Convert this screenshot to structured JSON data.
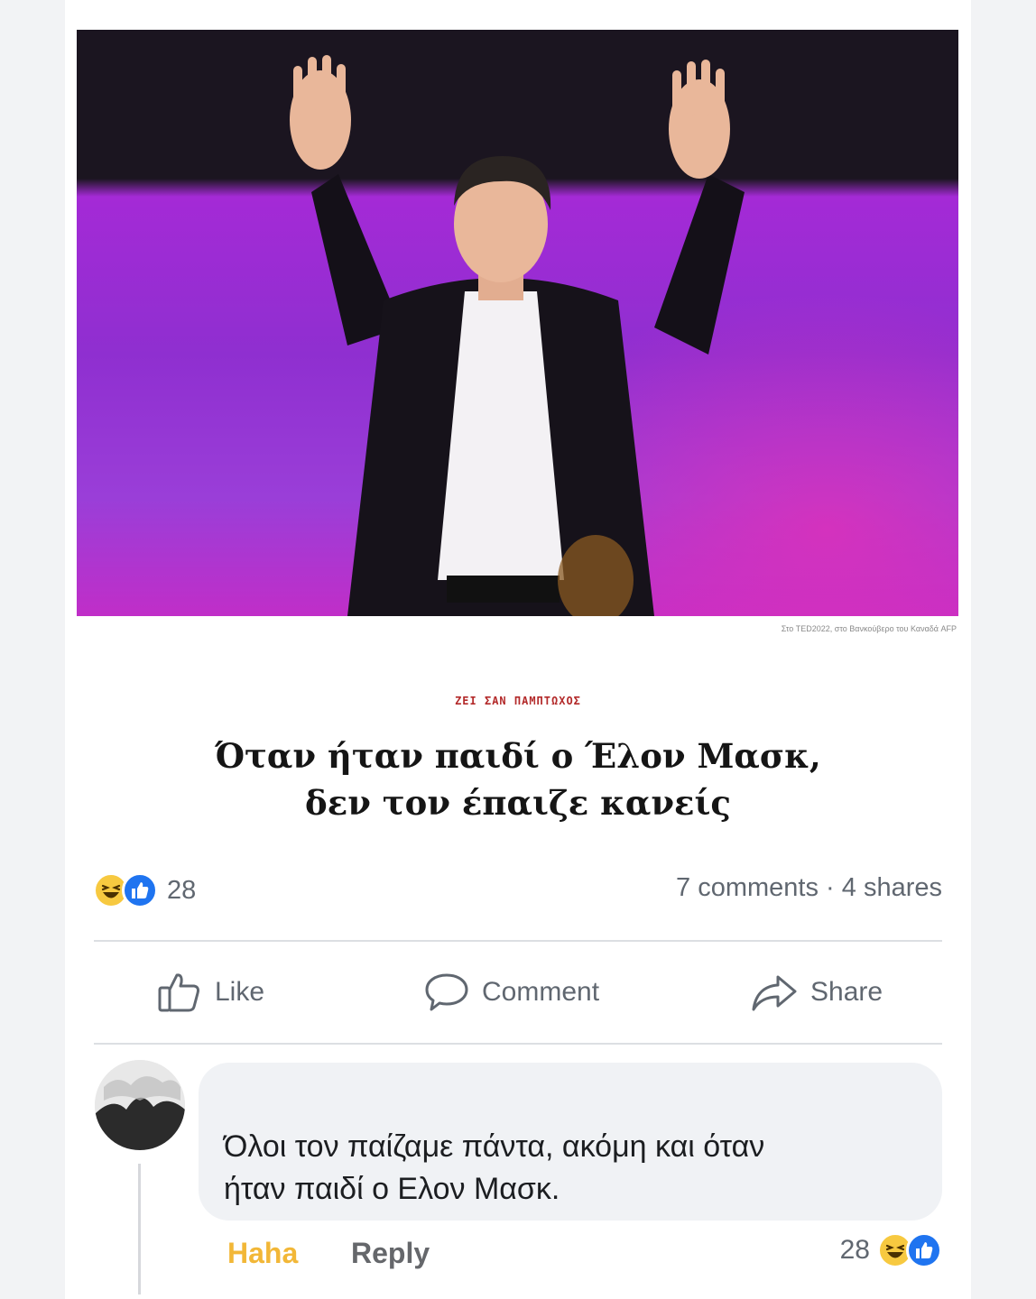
{
  "article": {
    "photo_caption": "Στο TED2022, στο Βανκούβερο του Καναδά  AFP",
    "kicker": "ΖΕΙ ΣΑΝ ΠΑΜΠΤΩΧΟΣ",
    "headline_line1": "Όταν ήταν παιδί ο Έλον Μασκ,",
    "headline_line2": "δεν τον έπαιζε κανείς"
  },
  "post_stats": {
    "reaction_count": "28",
    "comments_shares": "7 comments · 4 shares",
    "reaction_icons": [
      "haha-emoji-icon",
      "like-emoji-icon"
    ]
  },
  "actions": {
    "like": "Like",
    "comment": "Comment",
    "share": "Share"
  },
  "comment": {
    "text_line1": "Όλοι τον παίζαμε πάντα, ακόμη και όταν",
    "text_line2": "ήταν παιδί ο Ελον Μασκ.",
    "reaction_label": "Haha",
    "reply_label": "Reply",
    "reaction_count": "28"
  },
  "colors": {
    "haha_accent": "#f2b737",
    "like_blue": "#1f74f0",
    "kicker_red": "#b32a2a",
    "stage_purple": "#a42ad6"
  }
}
